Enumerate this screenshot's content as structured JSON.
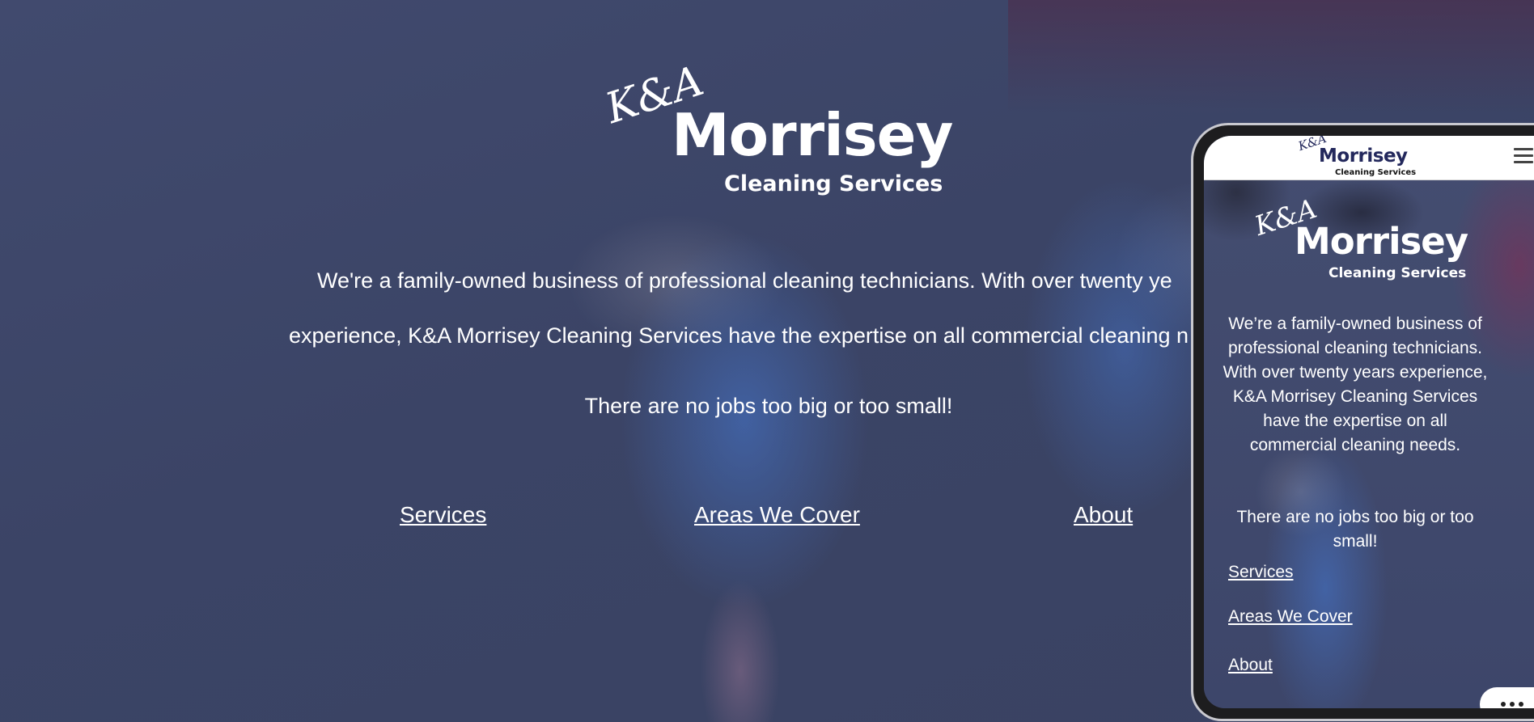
{
  "brand": {
    "ka": "K&A",
    "name": "Morrisey",
    "tagline": "Cleaning Services"
  },
  "hero": {
    "line1": "We're a family-owned business of professional cleaning technicians. With over twenty ye",
    "line2": "experience, K&A Morrisey Cleaning Services have the expertise on all commercial cleaning n",
    "line3": "There are no jobs too big or too small!"
  },
  "nav": {
    "services": "Services",
    "areas": "Areas We Cover",
    "about": "About"
  },
  "mobile": {
    "paragraph1": "We’re a family-owned business of professional cleaning technicians. With over twenty years experience, K&A Morrisey Cleaning Services have the expertise on all commercial cleaning needs.",
    "paragraph2": "There are no jobs too big or too small!",
    "links": {
      "services": "Services",
      "areas": "Areas We Cover",
      "about": "About"
    },
    "menu_icon": "hamburger-icon",
    "more_icon": "more-dots-icon"
  },
  "colors": {
    "overlay": "#3b4466",
    "brand_navy": "#23285c",
    "text": "#ffffff"
  }
}
